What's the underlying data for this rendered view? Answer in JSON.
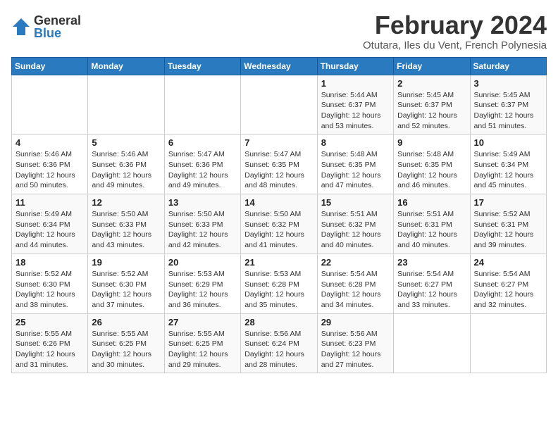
{
  "logo": {
    "general": "General",
    "blue": "Blue"
  },
  "title": "February 2024",
  "subtitle": "Otutara, Iles du Vent, French Polynesia",
  "days_of_week": [
    "Sunday",
    "Monday",
    "Tuesday",
    "Wednesday",
    "Thursday",
    "Friday",
    "Saturday"
  ],
  "weeks": [
    [
      {
        "day": "",
        "info": ""
      },
      {
        "day": "",
        "info": ""
      },
      {
        "day": "",
        "info": ""
      },
      {
        "day": "",
        "info": ""
      },
      {
        "day": "1",
        "info": "Sunrise: 5:44 AM\nSunset: 6:37 PM\nDaylight: 12 hours\nand 53 minutes."
      },
      {
        "day": "2",
        "info": "Sunrise: 5:45 AM\nSunset: 6:37 PM\nDaylight: 12 hours\nand 52 minutes."
      },
      {
        "day": "3",
        "info": "Sunrise: 5:45 AM\nSunset: 6:37 PM\nDaylight: 12 hours\nand 51 minutes."
      }
    ],
    [
      {
        "day": "4",
        "info": "Sunrise: 5:46 AM\nSunset: 6:36 PM\nDaylight: 12 hours\nand 50 minutes."
      },
      {
        "day": "5",
        "info": "Sunrise: 5:46 AM\nSunset: 6:36 PM\nDaylight: 12 hours\nand 49 minutes."
      },
      {
        "day": "6",
        "info": "Sunrise: 5:47 AM\nSunset: 6:36 PM\nDaylight: 12 hours\nand 49 minutes."
      },
      {
        "day": "7",
        "info": "Sunrise: 5:47 AM\nSunset: 6:35 PM\nDaylight: 12 hours\nand 48 minutes."
      },
      {
        "day": "8",
        "info": "Sunrise: 5:48 AM\nSunset: 6:35 PM\nDaylight: 12 hours\nand 47 minutes."
      },
      {
        "day": "9",
        "info": "Sunrise: 5:48 AM\nSunset: 6:35 PM\nDaylight: 12 hours\nand 46 minutes."
      },
      {
        "day": "10",
        "info": "Sunrise: 5:49 AM\nSunset: 6:34 PM\nDaylight: 12 hours\nand 45 minutes."
      }
    ],
    [
      {
        "day": "11",
        "info": "Sunrise: 5:49 AM\nSunset: 6:34 PM\nDaylight: 12 hours\nand 44 minutes."
      },
      {
        "day": "12",
        "info": "Sunrise: 5:50 AM\nSunset: 6:33 PM\nDaylight: 12 hours\nand 43 minutes."
      },
      {
        "day": "13",
        "info": "Sunrise: 5:50 AM\nSunset: 6:33 PM\nDaylight: 12 hours\nand 42 minutes."
      },
      {
        "day": "14",
        "info": "Sunrise: 5:50 AM\nSunset: 6:32 PM\nDaylight: 12 hours\nand 41 minutes."
      },
      {
        "day": "15",
        "info": "Sunrise: 5:51 AM\nSunset: 6:32 PM\nDaylight: 12 hours\nand 40 minutes."
      },
      {
        "day": "16",
        "info": "Sunrise: 5:51 AM\nSunset: 6:31 PM\nDaylight: 12 hours\nand 40 minutes."
      },
      {
        "day": "17",
        "info": "Sunrise: 5:52 AM\nSunset: 6:31 PM\nDaylight: 12 hours\nand 39 minutes."
      }
    ],
    [
      {
        "day": "18",
        "info": "Sunrise: 5:52 AM\nSunset: 6:30 PM\nDaylight: 12 hours\nand 38 minutes."
      },
      {
        "day": "19",
        "info": "Sunrise: 5:52 AM\nSunset: 6:30 PM\nDaylight: 12 hours\nand 37 minutes."
      },
      {
        "day": "20",
        "info": "Sunrise: 5:53 AM\nSunset: 6:29 PM\nDaylight: 12 hours\nand 36 minutes."
      },
      {
        "day": "21",
        "info": "Sunrise: 5:53 AM\nSunset: 6:28 PM\nDaylight: 12 hours\nand 35 minutes."
      },
      {
        "day": "22",
        "info": "Sunrise: 5:54 AM\nSunset: 6:28 PM\nDaylight: 12 hours\nand 34 minutes."
      },
      {
        "day": "23",
        "info": "Sunrise: 5:54 AM\nSunset: 6:27 PM\nDaylight: 12 hours\nand 33 minutes."
      },
      {
        "day": "24",
        "info": "Sunrise: 5:54 AM\nSunset: 6:27 PM\nDaylight: 12 hours\nand 32 minutes."
      }
    ],
    [
      {
        "day": "25",
        "info": "Sunrise: 5:55 AM\nSunset: 6:26 PM\nDaylight: 12 hours\nand 31 minutes."
      },
      {
        "day": "26",
        "info": "Sunrise: 5:55 AM\nSunset: 6:25 PM\nDaylight: 12 hours\nand 30 minutes."
      },
      {
        "day": "27",
        "info": "Sunrise: 5:55 AM\nSunset: 6:25 PM\nDaylight: 12 hours\nand 29 minutes."
      },
      {
        "day": "28",
        "info": "Sunrise: 5:56 AM\nSunset: 6:24 PM\nDaylight: 12 hours\nand 28 minutes."
      },
      {
        "day": "29",
        "info": "Sunrise: 5:56 AM\nSunset: 6:23 PM\nDaylight: 12 hours\nand 27 minutes."
      },
      {
        "day": "",
        "info": ""
      },
      {
        "day": "",
        "info": ""
      }
    ]
  ]
}
